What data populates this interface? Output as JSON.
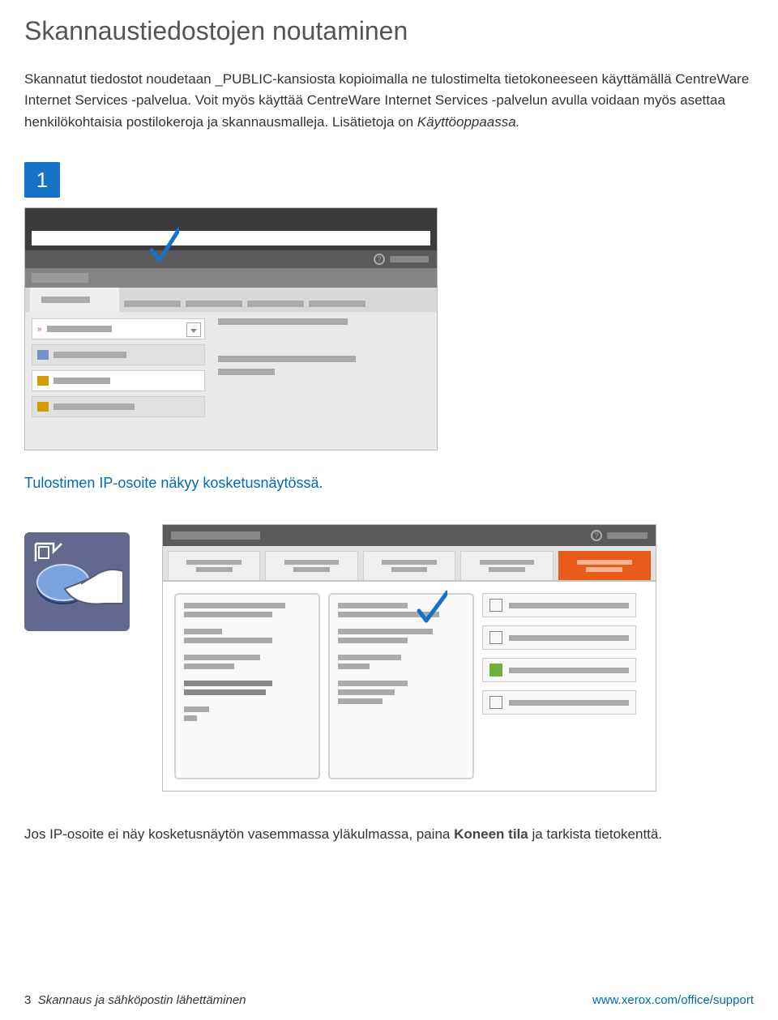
{
  "title": "Skannaustiedostojen noutaminen",
  "intro_1": "Skannatut tiedostot noudetaan _PUBLIC-kansiosta kopioimalla ne tulostimelta tietokoneeseen käyttämällä CentreWare Internet Services -palvelua. Voit myös käyttää CentreWare Internet Services -palvelun avulla voidaan myös asettaa henkilökohtaisia postilokeroja ja skannausmalleja. Lisätietoja on ",
  "intro_italic": "Käyttöoppaassa.",
  "step1_number": "1",
  "caption1": "Tulostimen IP-osoite näkyy kosketusnäytössä.",
  "note2_a": "Jos IP-osoite ei näy kosketusnäytön vasemmassa yläkulmassa, paina ",
  "note2_bold": "Koneen tila",
  "note2_b": " ja tarkista tietokenttä.",
  "footer_page": "3",
  "footer_title": "Skannaus ja sähköpostin lähettäminen",
  "footer_url": "www.xerox.com/office/support"
}
